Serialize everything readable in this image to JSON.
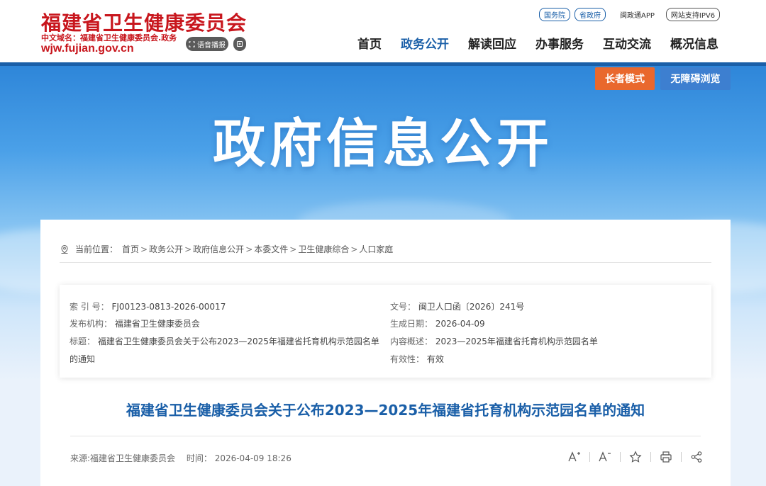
{
  "header": {
    "logo_title": "福建省卫生健康委员会",
    "logo_cn_domain": "中文域名：福建省卫生健康委员会.政务",
    "logo_domain": "wjw.fujian.gov.cn",
    "pill_label": "语音播报",
    "top_links": [
      "国务院",
      "省政府"
    ],
    "app_link": "闽政通APP",
    "ipv6": "网站支持IPV6",
    "nav": [
      "首页",
      "政务公开",
      "解读回应",
      "办事服务",
      "互动交流",
      "概况信息"
    ],
    "nav_active_index": 1
  },
  "banner": {
    "title": "政府信息公开",
    "elder_mode": "长者模式",
    "accessible": "无障碍浏览"
  },
  "breadcrumb": {
    "label": "当前位置：",
    "items": [
      "首页",
      "政务公开",
      "政府信息公开",
      "本委文件",
      "卫生健康综合",
      "人口家庭"
    ]
  },
  "meta": {
    "index_label": "索 引 号：",
    "index_value": "FJ00123-0813-2026-00017",
    "docno_label": "文号：",
    "docno_value": "闽卫人口函〔2026〕241号",
    "publisher_label": "发布机构：",
    "publisher_value": "福建省卫生健康委员会",
    "date_label": "生成日期：",
    "date_value": "2026-04-09",
    "title_label": "标题：",
    "title_value_1": "福建省卫生健康委员会关于公布2023—2025年福建省托育机构示范园名单",
    "title_value_2": "的通知",
    "summary_label": "内容概述：",
    "summary_value": "2023—2025年福建省托育机构示范园名单",
    "validity_label": "有效性：",
    "validity_value": "有效"
  },
  "article": {
    "title": "福建省卫生健康委员会关于公布2023—2025年福建省托育机构示范园名单的通知",
    "source": "来源:福建省卫生健康委员会",
    "time": "时间：  2026-04-09 18:26"
  },
  "colors": {
    "brand_red": "#c8161d",
    "brand_blue": "#1a5fa8",
    "elder_orange": "#e9682d"
  }
}
